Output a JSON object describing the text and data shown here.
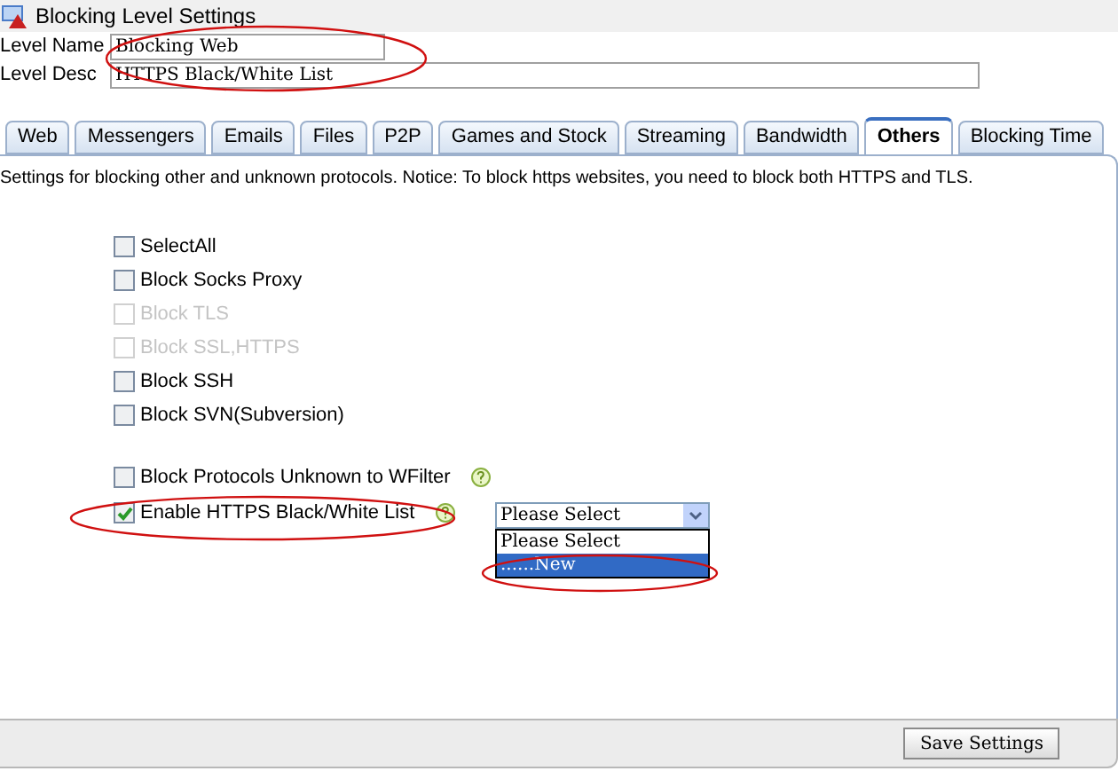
{
  "window": {
    "title": "Blocking Level Settings"
  },
  "fields": [
    {
      "label": "Level Name",
      "value": "Blocking Web"
    },
    {
      "label": "Level Desc",
      "value": "HTTPS Black/White List"
    }
  ],
  "tabs": [
    {
      "label": "Web",
      "selected": false
    },
    {
      "label": "Messengers",
      "selected": false
    },
    {
      "label": "Emails",
      "selected": false
    },
    {
      "label": "Files",
      "selected": false
    },
    {
      "label": "P2P",
      "selected": false
    },
    {
      "label": "Games and Stock",
      "selected": false
    },
    {
      "label": "Streaming",
      "selected": false
    },
    {
      "label": "Bandwidth",
      "selected": false
    },
    {
      "label": "Others",
      "selected": true
    },
    {
      "label": "Blocking Time",
      "selected": false
    }
  ],
  "notice": "Settings for blocking other and unknown protocols. Notice: To block https websites, you need to block both HTTPS and TLS.",
  "protocol_options": [
    {
      "label": "SelectAll",
      "checked": false,
      "disabled": false
    },
    {
      "label": "Block Socks Proxy",
      "checked": false,
      "disabled": false
    },
    {
      "label": "Block TLS",
      "checked": false,
      "disabled": true
    },
    {
      "label": "Block SSL,HTTPS",
      "checked": false,
      "disabled": true
    },
    {
      "label": "Block SSH",
      "checked": false,
      "disabled": false
    },
    {
      "label": "Block SVN(Subversion)",
      "checked": false,
      "disabled": false
    }
  ],
  "extra_options": [
    {
      "label": "Block Protocols Unknown to WFilter",
      "checked": false,
      "disabled": false
    },
    {
      "label": "Enable HTTPS Black/White List",
      "checked": true,
      "disabled": false
    }
  ],
  "list_select": {
    "value": "Please Select",
    "options": [
      {
        "label": "Please Select",
        "highlighted": false
      },
      {
        "label": "......New",
        "highlighted": true
      }
    ]
  },
  "save_button": "Save Settings"
}
